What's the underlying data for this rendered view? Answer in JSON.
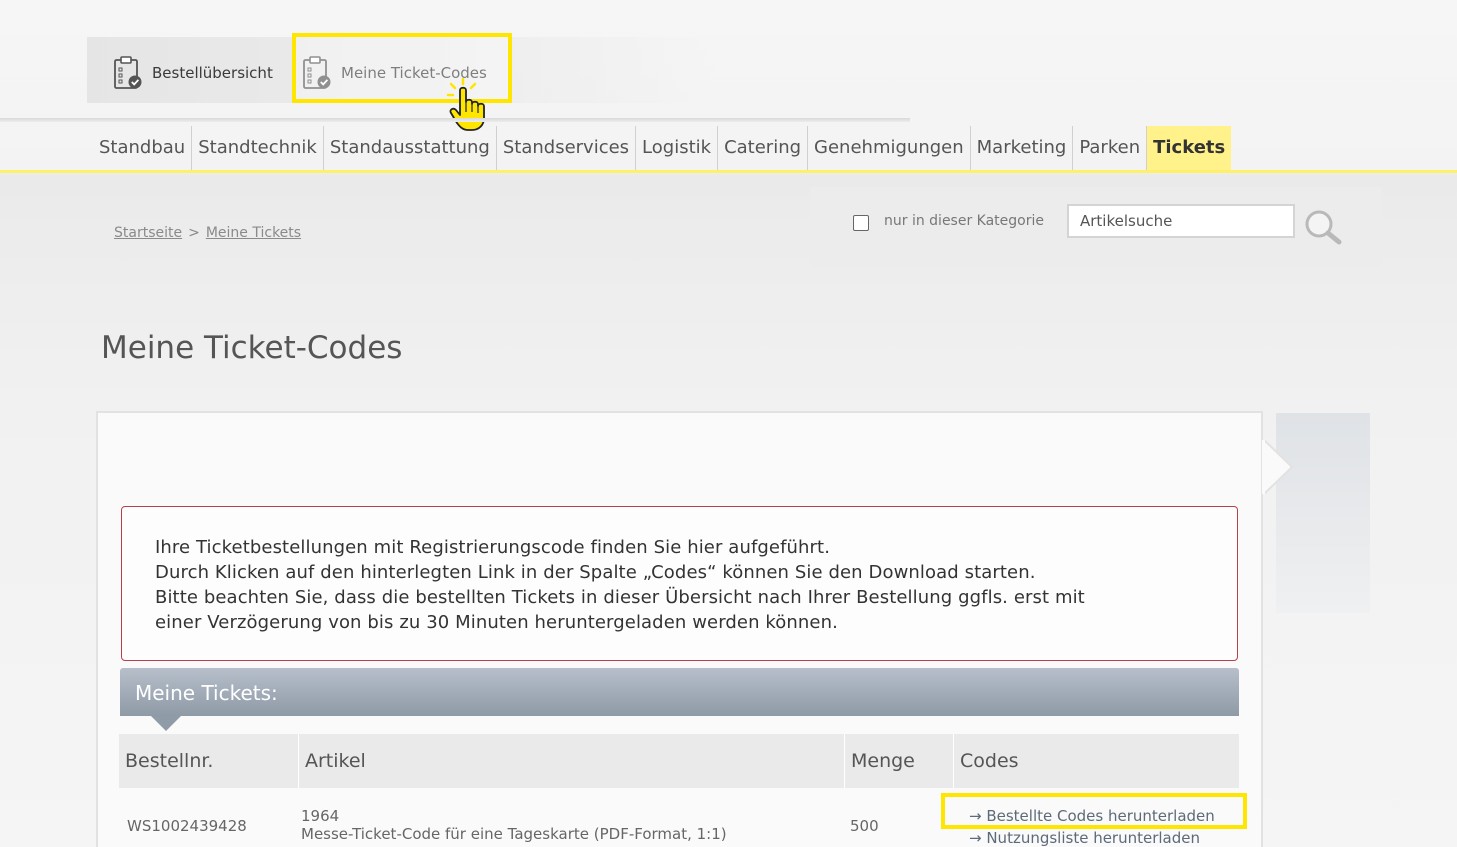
{
  "top_tabs": {
    "order_overview": "Bestellübersicht",
    "my_ticket_codes": "Meine Ticket-Codes"
  },
  "nav": {
    "items": [
      "Standbau",
      "Standtechnik",
      "Standausstattung",
      "Standservices",
      "Logistik",
      "Catering",
      "Genehmigungen",
      "Marketing",
      "Parken",
      "Tickets"
    ],
    "active": "Tickets"
  },
  "breadcrumb": {
    "home": "Startseite",
    "separator": ">",
    "current": "Meine Tickets"
  },
  "search": {
    "checkbox_label": "nur in dieser Kategorie",
    "placeholder": "Artikelsuche"
  },
  "page": {
    "title": "Meine Ticket-Codes"
  },
  "notice": {
    "lines": [
      "Ihre Ticketbestellungen mit Registrierungscode finden Sie hier aufgeführt.",
      "Durch Klicken auf den hinterlegten Link in der Spalte „Codes“ können Sie den Download starten.",
      "Bitte beachten Sie, dass die bestellten Tickets in dieser Übersicht nach Ihrer Bestellung ggfls. erst mit",
      "einer Verzögerung von bis zu 30 Minuten heruntergeladen werden können."
    ]
  },
  "tickets": {
    "header": "Meine Tickets:",
    "columns": [
      "Bestellnr.",
      "Artikel",
      "Menge",
      "Codes"
    ],
    "rows": [
      {
        "order_no": "WS1002439428",
        "article_line1": "1964",
        "article_line2": "Messe-Ticket-Code für eine Tageskarte (PDF-Format, 1:1)",
        "qty": "500",
        "link_download_codes": "→ Bestellte Codes herunterladen",
        "link_download_usage": "→ Nutzungsliste herunterladen"
      }
    ]
  },
  "colors": {
    "highlight": "#ffe600",
    "nav_active_bg": "#fff28a",
    "notice_border": "#b8404a",
    "header_bar": "#9aa5b2"
  }
}
